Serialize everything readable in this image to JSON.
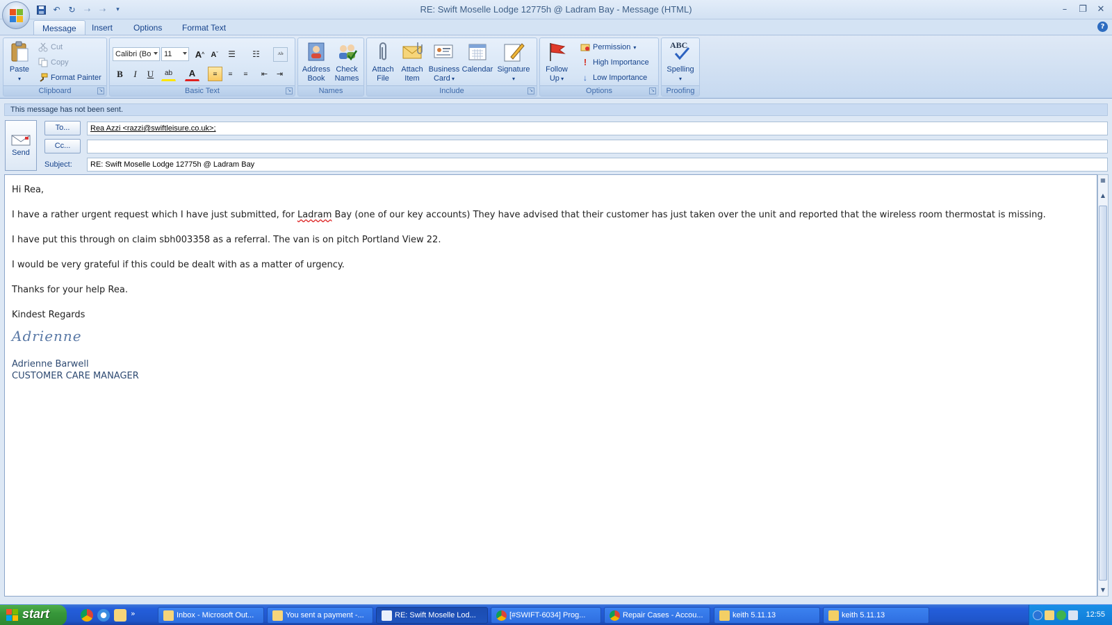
{
  "window": {
    "title": "RE: Swift Moselle Lodge 12775h @ Ladram Bay - Message (HTML)",
    "controls": [
      "minimize",
      "restore",
      "close"
    ]
  },
  "ribbon_tabs": [
    {
      "label": "Message",
      "active": true
    },
    {
      "label": "Insert",
      "active": false
    },
    {
      "label": "Options",
      "active": false
    },
    {
      "label": "Format Text",
      "active": false
    }
  ],
  "ribbon": {
    "clipboard": {
      "label": "Clipboard",
      "paste": "Paste",
      "cut": "Cut",
      "copy": "Copy",
      "format_painter": "Format Painter"
    },
    "basic_text": {
      "label": "Basic Text",
      "font": "Calibri (Bo",
      "size": "11",
      "bold": "B",
      "italic": "I",
      "underline": "U",
      "font_color": "A"
    },
    "names": {
      "label": "Names",
      "address_book": [
        "Address",
        "Book"
      ],
      "check_names": [
        "Check",
        "Names"
      ]
    },
    "include": {
      "label": "Include",
      "attach_file": [
        "Attach",
        "File"
      ],
      "attach_item": [
        "Attach",
        "Item"
      ],
      "business_card": [
        "Business",
        "Card"
      ],
      "calendar": "Calendar",
      "signature": "Signature"
    },
    "options": {
      "label": "Options",
      "follow_up": [
        "Follow",
        "Up"
      ],
      "permission": "Permission",
      "high_importance": "High Importance",
      "low_importance": "Low Importance"
    },
    "proofing": {
      "label": "Proofing",
      "spelling": "Spelling",
      "abc": "ABC"
    }
  },
  "message": {
    "info": "This message has not been sent.",
    "send_label": "Send",
    "to_button": "To...",
    "cc_button": "Cc...",
    "subject_label": "Subject:",
    "to_value": "Rea Azzi <razzi@swiftleisure.co.uk>;",
    "cc_value": "",
    "subject_value": "RE: Swift Moselle Lodge 12775h @ Ladram Bay"
  },
  "body": {
    "greeting": "Hi Rea,",
    "para1_pre": "I have a rather urgent request which I have just submitted, for ",
    "para1_misspelled": "Ladram",
    "para1_post": " Bay (one of our key accounts)  They have advised that their customer has just taken over the unit and reported that the wireless room thermostat is missing.",
    "para2": "I have put this through on claim sbh003358 as a referral.  The van is on pitch Portland View 22.",
    "para3": "I would be very grateful if this could be dealt with as a matter of urgency.",
    "para4": "Thanks for your help Rea.",
    "closing": "Kindest Regards",
    "signature_script": "Adrienne",
    "signature_name": "Adrienne Barwell",
    "signature_title": "CUSTOMER CARE MANAGER"
  },
  "taskbar": {
    "start_label": "start",
    "tasks": [
      {
        "label": "Inbox - Microsoft Out...",
        "active": false
      },
      {
        "label": "You sent a payment -...",
        "active": false
      },
      {
        "label": "RE: Swift Moselle Lod...",
        "active": true
      },
      {
        "label": "[#SWIFT-6034] Prog...",
        "active": false
      },
      {
        "label": "Repair Cases - Accou...",
        "active": false
      },
      {
        "label": "keith 5.11.13",
        "active": false
      },
      {
        "label": "keith 5.11.13",
        "active": false
      }
    ],
    "clock": "12:55"
  },
  "colors": {
    "ribbon_bg": "#c6d9f0",
    "taskbar_blue": "#245edb",
    "start_green": "#37973a",
    "accent_text": "#15428b"
  }
}
